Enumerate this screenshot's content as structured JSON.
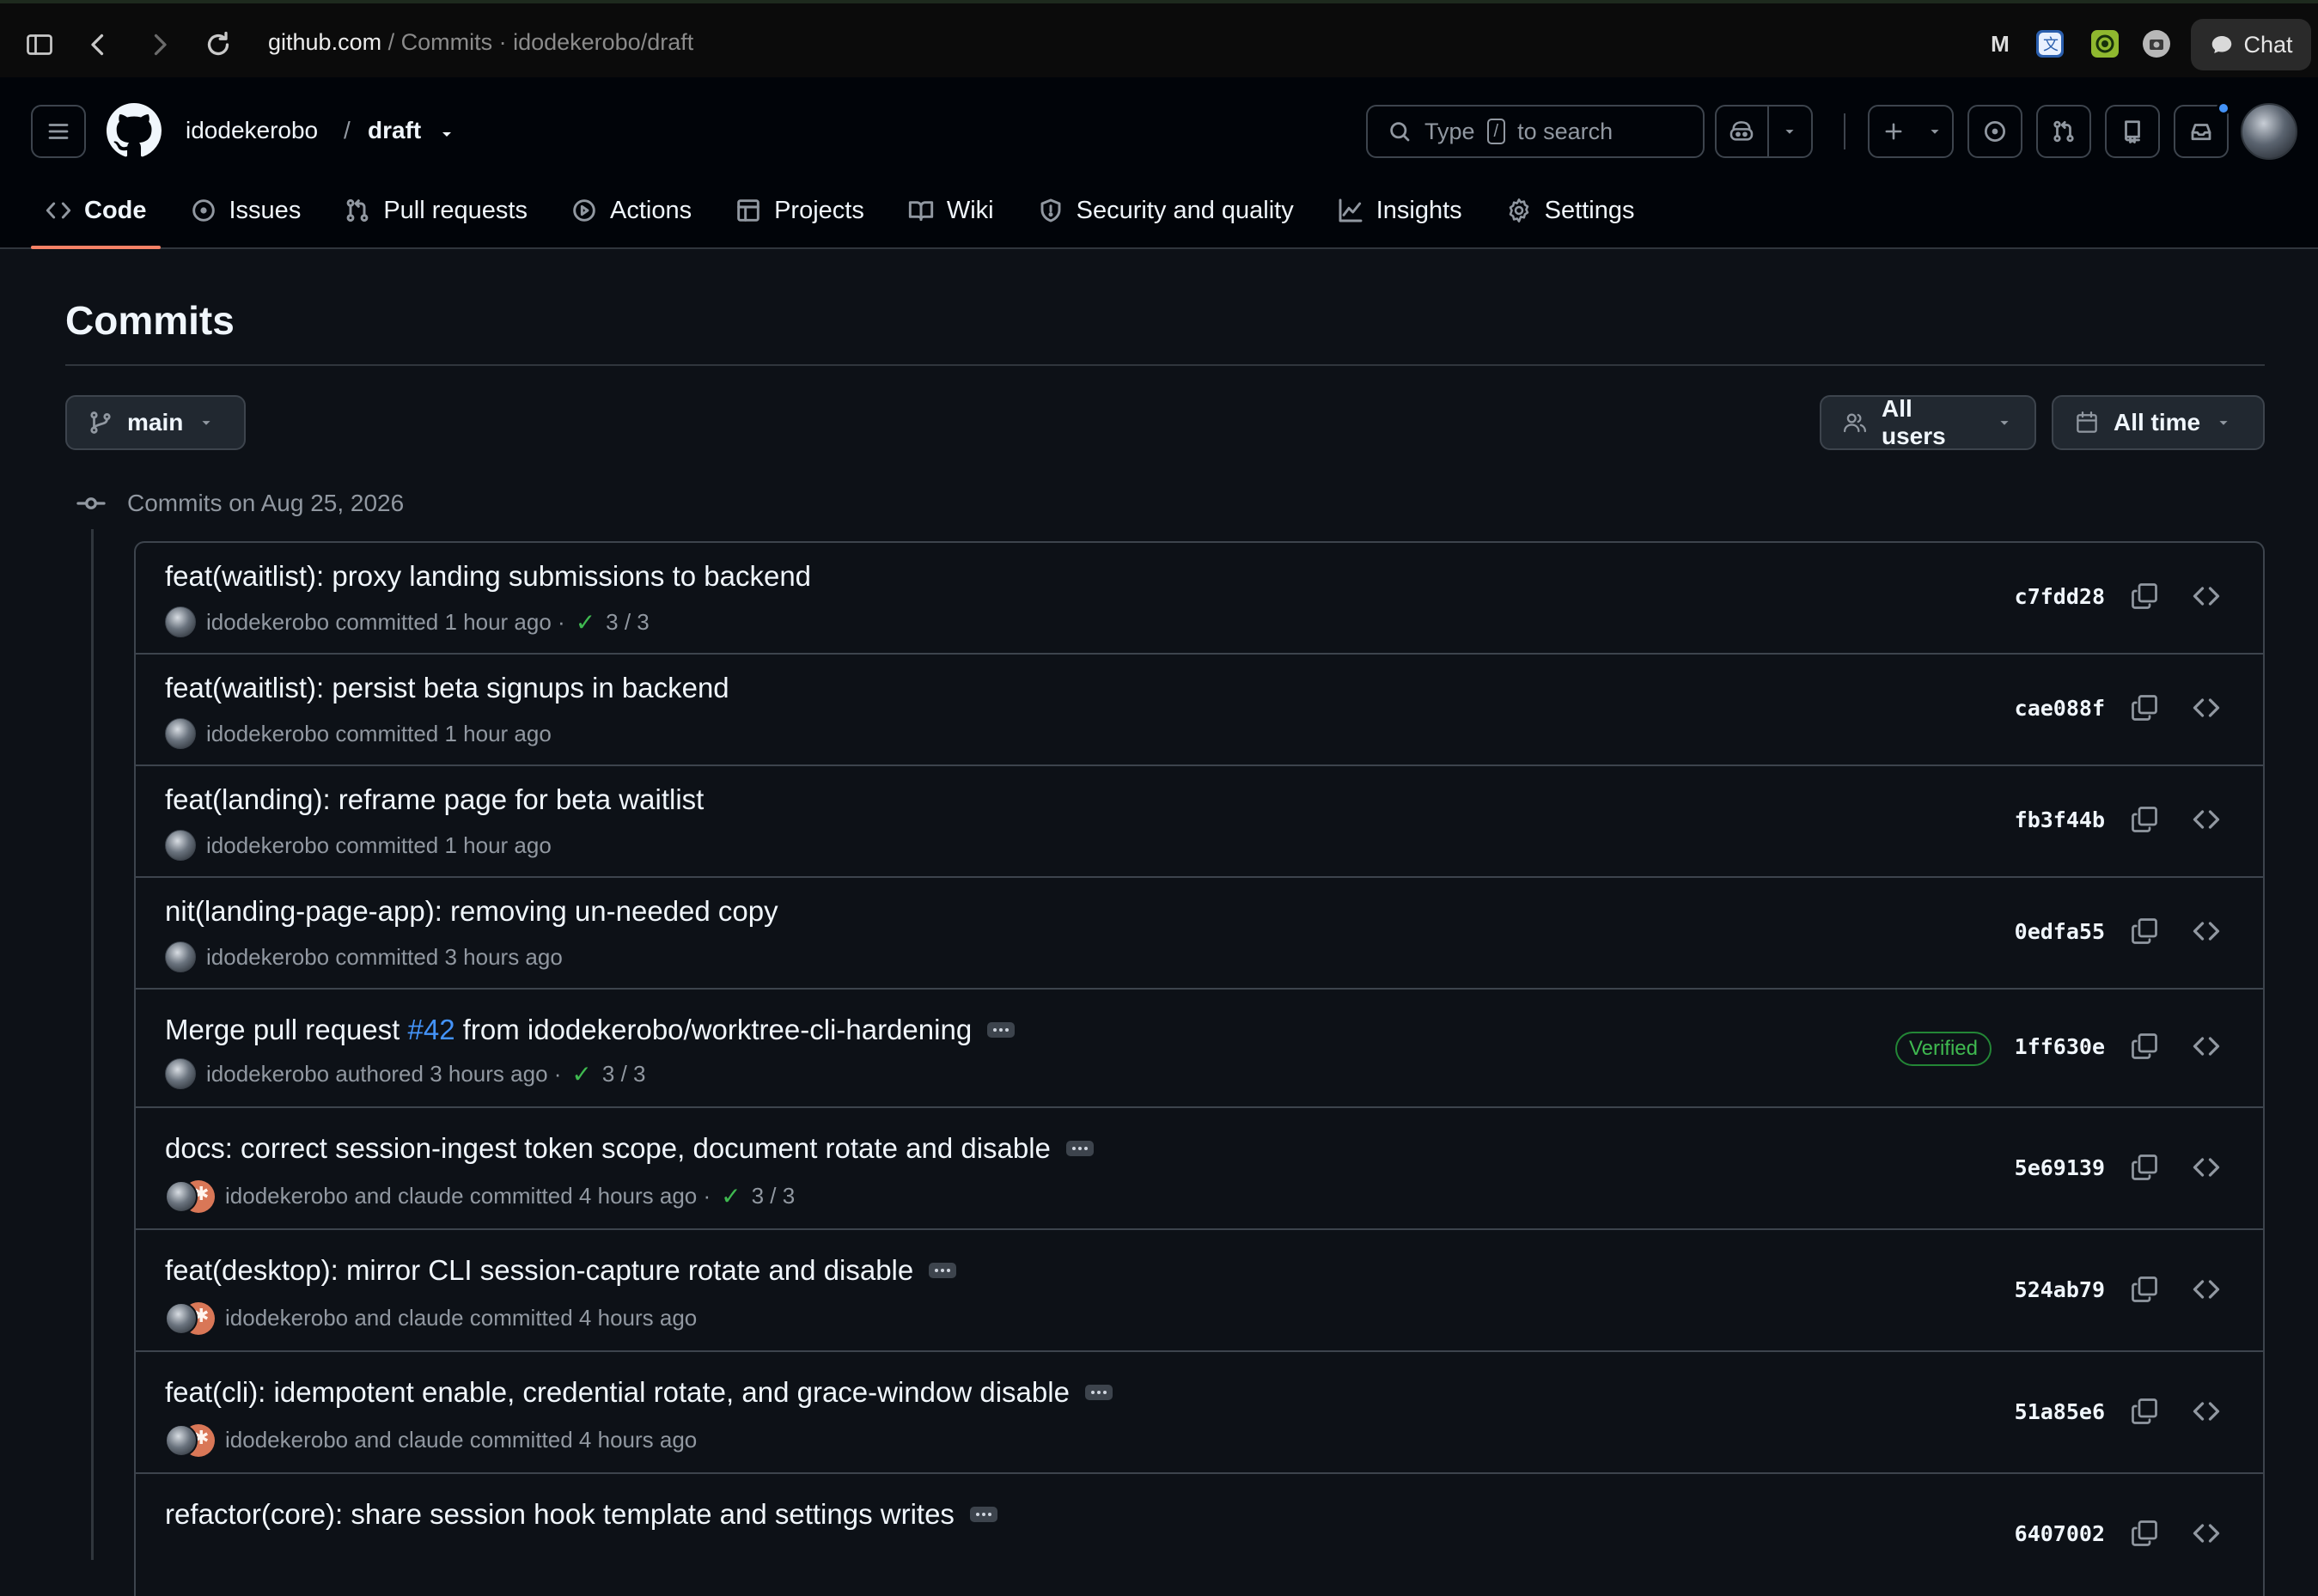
{
  "browser": {
    "url_host": "github.com",
    "url_rest": " / Commits · idodekerobo/draft",
    "chat_label": "Chat",
    "extensions": [
      "m-icon",
      "translate-extension-icon",
      "swirl-extension-icon",
      "camera-extension-icon"
    ]
  },
  "header": {
    "owner": "idodekerobo",
    "separator": "/",
    "repo": "draft",
    "search_prefix": "Type",
    "search_key": "/",
    "search_suffix": "to search",
    "accent_color": "#f78166"
  },
  "tabs": [
    {
      "label": "Code",
      "icon": "code-icon",
      "active": true
    },
    {
      "label": "Issues",
      "icon": "issue-icon"
    },
    {
      "label": "Pull requests",
      "icon": "pull-request-icon"
    },
    {
      "label": "Actions",
      "icon": "play-icon"
    },
    {
      "label": "Projects",
      "icon": "table-icon"
    },
    {
      "label": "Wiki",
      "icon": "book-icon"
    },
    {
      "label": "Security and quality",
      "icon": "shield-icon"
    },
    {
      "label": "Insights",
      "icon": "graph-icon"
    },
    {
      "label": "Settings",
      "icon": "gear-icon"
    }
  ],
  "page": {
    "title": "Commits",
    "branch": "main",
    "users_filter": "All users",
    "time_filter": "All time",
    "group_heading": "Commits on Aug 25, 2026"
  },
  "commits": [
    {
      "title": "feat(waitlist): proxy landing submissions to backend",
      "meta": "idodekerobo committed 1 hour ago ·",
      "checks": "3 / 3",
      "sha": "c7fdd28"
    },
    {
      "title": "feat(waitlist): persist beta signups in backend",
      "meta": "idodekerobo committed 1 hour ago",
      "sha": "cae088f"
    },
    {
      "title": "feat(landing): reframe page for beta waitlist",
      "meta": "idodekerobo committed 1 hour ago",
      "sha": "fb3f44b"
    },
    {
      "title": "nit(landing-page-app): removing un-needed copy",
      "meta": "idodekerobo committed 3 hours ago",
      "sha": "0edfa55"
    },
    {
      "title_a": "Merge pull request ",
      "pr": "#42",
      "title_b": " from idodekerobo/worktree-cli-hardening",
      "meta": "idodekerobo authored 3 hours ago ·",
      "checks": "3 / 3",
      "verified": "Verified",
      "sha": "1ff630e"
    },
    {
      "title": "docs: correct session-ingest token scope, document rotate and disable",
      "meta": "idodekerobo and claude committed 4 hours ago ·",
      "checks": "3 / 3",
      "sha": "5e69139"
    },
    {
      "title": "feat(desktop): mirror CLI session-capture rotate and disable",
      "meta": "idodekerobo and claude committed 4 hours ago",
      "sha": "524ab79"
    },
    {
      "title": "feat(cli): idempotent enable, credential rotate, and grace-window disable",
      "meta": "idodekerobo and claude committed 4 hours ago",
      "sha": "51a85e6"
    },
    {
      "title": "refactor(core): share session hook template and settings writes",
      "sha": "6407002"
    }
  ]
}
